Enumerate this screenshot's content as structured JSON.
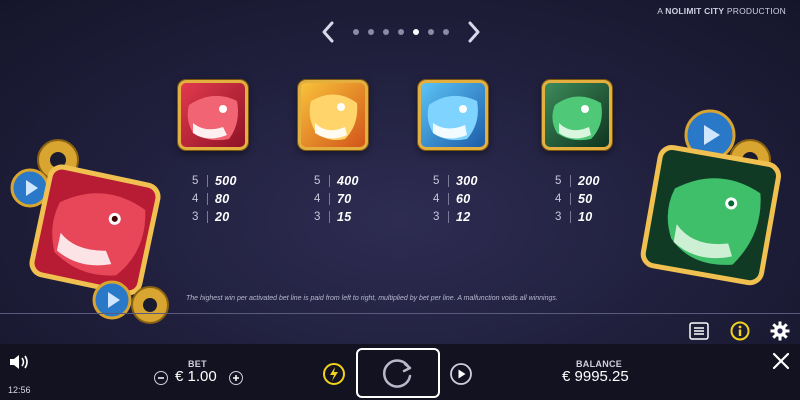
{
  "header": {
    "brand_prefix": "A",
    "brand_name": "NOLIMIT CITY",
    "brand_suffix": "PRODUCTION"
  },
  "pager": {
    "total": 7,
    "active_index": 4,
    "prev_icon": "chevron-left-icon",
    "next_icon": "chevron-right-icon"
  },
  "paytable": [
    {
      "symbol": "red-dragon-icon",
      "color": "#d8283c",
      "rows": [
        {
          "count": "5",
          "value": "500"
        },
        {
          "count": "4",
          "value": "80"
        },
        {
          "count": "3",
          "value": "20"
        }
      ]
    },
    {
      "symbol": "orange-dragon-icon",
      "color": "#f08a1a",
      "rows": [
        {
          "count": "5",
          "value": "400"
        },
        {
          "count": "4",
          "value": "70"
        },
        {
          "count": "3",
          "value": "15"
        }
      ]
    },
    {
      "symbol": "blue-dragon-icon",
      "color": "#2f8fe0",
      "rows": [
        {
          "count": "5",
          "value": "300"
        },
        {
          "count": "4",
          "value": "60"
        },
        {
          "count": "3",
          "value": "12"
        }
      ]
    },
    {
      "symbol": "green-dragon-icon",
      "color": "#2aa85a",
      "rows": [
        {
          "count": "5",
          "value": "200"
        },
        {
          "count": "4",
          "value": "50"
        },
        {
          "count": "3",
          "value": "10"
        }
      ]
    }
  ],
  "disclaimer": "The highest win per activated bet line is paid from left to right, multiplied by bet per line. A malfunction voids all winnings.",
  "toolbar": {
    "paytable_icon": "list-icon",
    "info_icon": "info-icon",
    "settings_icon": "gear-icon"
  },
  "bottom_bar": {
    "clock": "12:56",
    "bet_label": "BET",
    "bet_value": "€ 1.00",
    "balance_label": "BALANCE",
    "balance_value": "€ 9995.25",
    "sound_icon": "speaker-icon",
    "turbo_icon": "lightning-icon",
    "spin_icon": "spin-icon",
    "autoplay_icon": "play-icon",
    "close_icon": "close-icon",
    "accent_color": "#f2d21a"
  }
}
